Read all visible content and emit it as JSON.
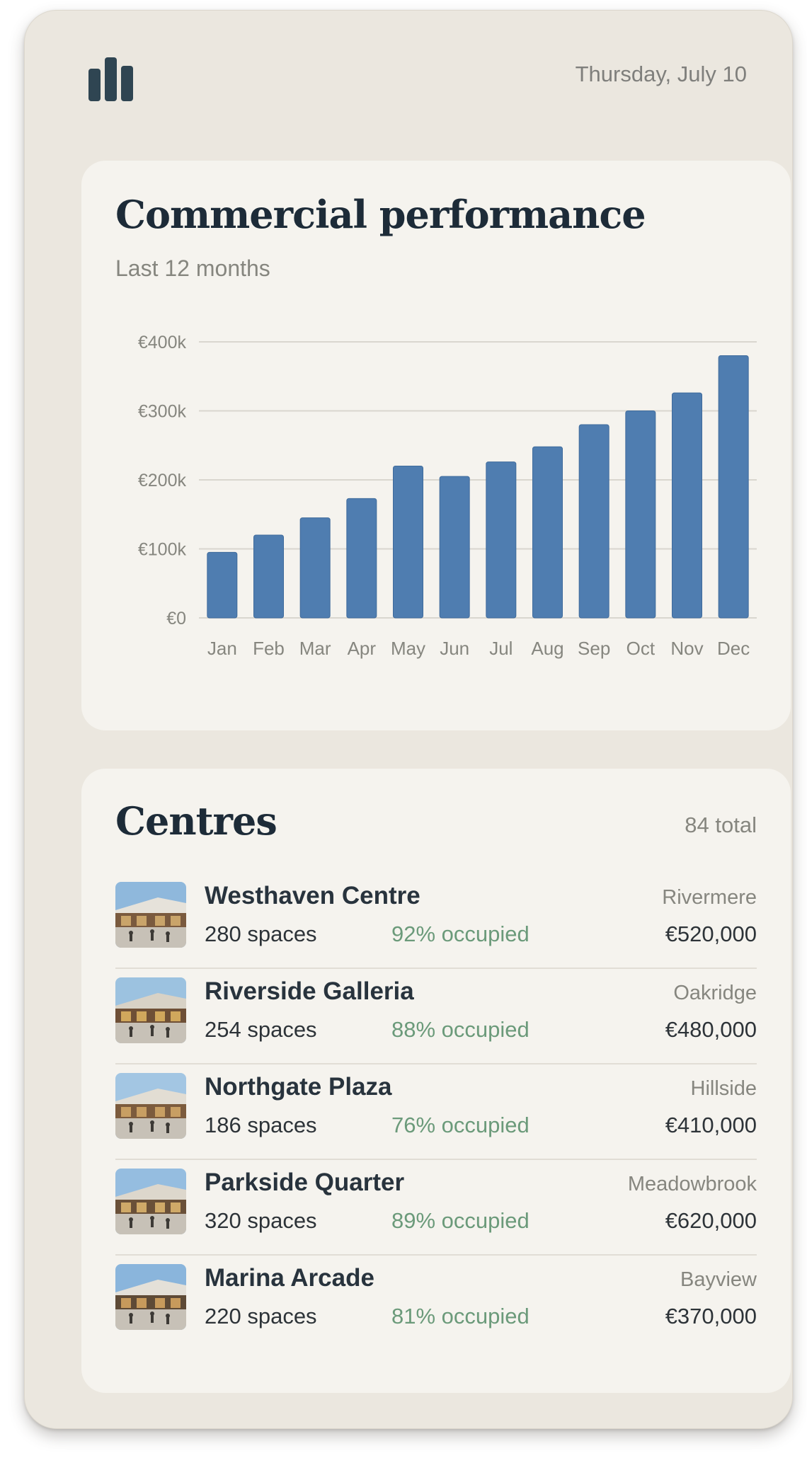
{
  "header": {
    "logo_icon": "bar-chart-icon",
    "date": "Thursday, July 10"
  },
  "performance": {
    "title": "Commercial performance",
    "subtitle": "Last 12 months"
  },
  "chart_data": {
    "type": "bar",
    "categories": [
      "Jan",
      "Feb",
      "Mar",
      "Apr",
      "May",
      "Jun",
      "Jul",
      "Aug",
      "Sep",
      "Oct",
      "Nov",
      "Dec"
    ],
    "values": [
      95000,
      120000,
      145000,
      173000,
      220000,
      205000,
      226000,
      248000,
      280000,
      300000,
      326000,
      380000
    ],
    "y_ticks": [
      "€0",
      "€100k",
      "€200k",
      "€300k",
      "€400k"
    ],
    "ylim": [
      0,
      400000
    ],
    "grid": true,
    "bar_color": "#4f7db0",
    "title": "",
    "xlabel": "",
    "ylabel": ""
  },
  "centres": {
    "title": "Centres",
    "total": "84 total",
    "items": [
      {
        "name": "Westhaven Centre",
        "city": "Rivermere",
        "spaces": "280 spaces",
        "occupancy": "92% occupied",
        "value": "€520,000"
      },
      {
        "name": "Riverside Galleria",
        "city": "Oakridge",
        "spaces": "254 spaces",
        "occupancy": "88% occupied",
        "value": "€480,000"
      },
      {
        "name": "Northgate Plaza",
        "city": "Hillside",
        "spaces": "186 spaces",
        "occupancy": "76% occupied",
        "value": "€410,000"
      },
      {
        "name": "Parkside Quarter",
        "city": "Meadowbrook",
        "spaces": "320 spaces",
        "occupancy": "89% occupied",
        "value": "€620,000"
      },
      {
        "name": "Marina Arcade",
        "city": "Bayview",
        "spaces": "220 spaces",
        "occupancy": "81% occupied",
        "value": "€370,000"
      }
    ]
  },
  "colors": {
    "accent": "#4f7db0",
    "occupancy_green": "#6b9a7a",
    "title_navy": "#1d2b38"
  }
}
